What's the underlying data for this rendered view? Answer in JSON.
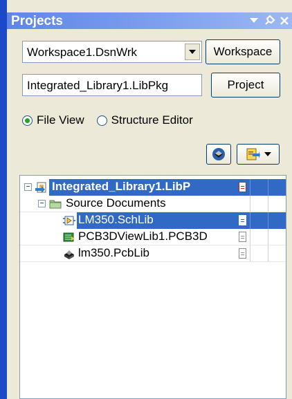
{
  "panel": {
    "title": "Projects",
    "title_icons": [
      "menu-arrow-icon",
      "pin-icon",
      "close-icon"
    ]
  },
  "workspace": {
    "selected": "Workspace1.DsnWrk",
    "button_label": "Workspace"
  },
  "project": {
    "value": "Integrated_Library1.LibPkg",
    "button_label": "Project"
  },
  "view_mode": {
    "options": [
      "File View",
      "Structure Editor"
    ],
    "selected": "File View"
  },
  "tree": {
    "root": "Integrated_Library1.LibP",
    "folder": "Source Documents",
    "items": [
      {
        "label": "LM350.SchLib",
        "selected": true
      },
      {
        "label": "PCB3DViewLib1.PCB3D",
        "selected": false
      },
      {
        "label": "lm350.PcbLib",
        "selected": false
      }
    ]
  },
  "colors": {
    "title_bar": "#7ea0ee",
    "selection": "#316ac5",
    "panel_bg": "#ece9d8",
    "left_edge": "#1c49c8"
  }
}
